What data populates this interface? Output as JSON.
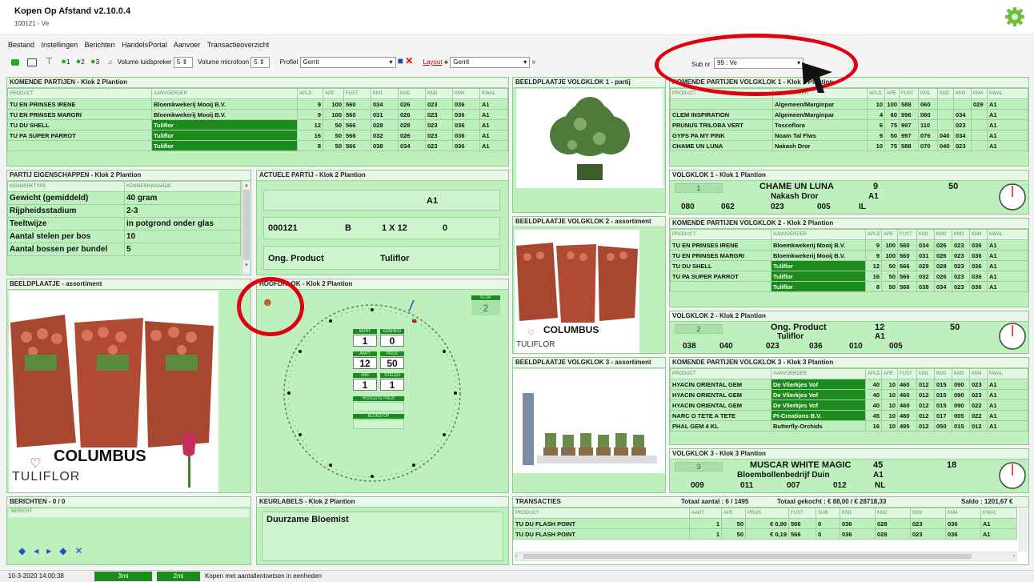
{
  "app": {
    "title": "Kopen Op Afstand v2.10.0.4",
    "subtitle": "100121 - Ve"
  },
  "menu": [
    "Bestand",
    "Instellingen",
    "Berichten",
    "HandelsPortal",
    "Aanvoer",
    "Transactieoverzicht"
  ],
  "toolbar": {
    "clock1": "1",
    "clock2": "2",
    "clock3": "3",
    "vol_speaker_label": "Volume luidspreker",
    "vol_speaker": "5",
    "vol_mic_label": "Volume microfoon",
    "vol_mic": "5",
    "profiel_label": "Profiel",
    "profiel": "Gerrit",
    "layout_label": "Layout",
    "layout": "Gerrit",
    "subnr_label": "Sub nr",
    "subnr": "99 : Ve"
  },
  "kp_main": {
    "title": "KOMENDE PARTIJEN - Klok 2 Plantion",
    "headers": [
      "PRODUCT",
      "AANVOERDER",
      "APLD",
      "APE",
      "FUST",
      "KM1",
      "KM2",
      "KM3",
      "KM4",
      "KWAL"
    ],
    "rows": [
      [
        "TU EN PRINSES IRENE",
        "Bloemkwekerij Mooij B.V.",
        "9",
        "100",
        "560",
        "034",
        "026",
        "023",
        "036",
        "A1"
      ],
      [
        "TU EN PRINSES MARGRI",
        "Bloemkwekerij Mooij B.V.",
        "9",
        "100",
        "560",
        "031",
        "026",
        "023",
        "036",
        "A1"
      ],
      [
        "TU DU SHELL",
        "Tuliflor",
        "12",
        "50",
        "566",
        "028",
        "028",
        "023",
        "036",
        "A1"
      ],
      [
        "TU PA SUPER PARROT",
        "Tuliflor",
        "16",
        "50",
        "566",
        "032",
        "026",
        "023",
        "036",
        "A1"
      ],
      [
        "",
        "Tuliflor",
        "8",
        "50",
        "566",
        "038",
        "034",
        "023",
        "036",
        "A1"
      ]
    ]
  },
  "eig": {
    "title": "PARTIJ EIGENSCHAPPEN - Klok 2 Plantion",
    "h1": "KENMERKTYPE",
    "h2": "KENMERKWAARDE",
    "rows": [
      [
        "Gewicht (gemiddeld)",
        "40 gram"
      ],
      [
        "Rijpheidsstadium",
        "2-3"
      ],
      [
        "Teeltwijze",
        "in potgrond onder glas"
      ],
      [
        "Aantal stelen per bos",
        "10"
      ],
      [
        "Aantal bossen per bundel",
        "5"
      ]
    ]
  },
  "actueel": {
    "title": "ACTUELE PARTIJ - Klok 2 Plantion",
    "kwal": "A1",
    "nr": "000121",
    "b": "B",
    "verp": "1 X 12",
    "zero": "0",
    "product": "Ong. Product",
    "aanvoerder": "Tuliflor"
  },
  "beeld_asso": {
    "title": "BEELDPLAATJE - assortiment",
    "brand": "COLUMBUS",
    "brand2": "TULIFLOR"
  },
  "hoofdklok": {
    "title": "HOOFDKLOK - Klok 2 Plantion",
    "klok_label": "KLOK",
    "klok": "2",
    "l1": "MUNT",
    "l2": "EENHEID",
    "v1": "1",
    "v2": "0",
    "l3": "AANT",
    "l4": "PRIJS",
    "v3": "12",
    "v4": "50",
    "l5": "MIN",
    "l6": "STELEN",
    "v5": "1",
    "v6": "1",
    "l7": "HOOGSTE PRIJS",
    "l8": "BLOKSTOP"
  },
  "berichten": {
    "title": "BERICHTEN - 0 / 0",
    "h": "BERICHT"
  },
  "keur": {
    "title": "KEURLABELS - Klok 2 Plantion",
    "item": "Duurzame Bloemist"
  },
  "bp1": {
    "title": "BEELDPLAATJE VOLGKLOK 1 - partij"
  },
  "bp2": {
    "title": "BEELDPLAATJE VOLGKLOK 2 - assortiment",
    "brand": "COLUMBUS",
    "brand2": "TULIFLOR"
  },
  "bp3": {
    "title": "BEELDPLAATJE VOLGKLOK 3 - assortiment"
  },
  "kpv1": {
    "title": "KOMENDE PARTIJEN VOLGKLOK 1 - Klok 1 Plantion",
    "headers": [
      "PRODUCT",
      "AANVOERDER",
      "APLD",
      "APE",
      "FUST",
      "KM1",
      "KM2",
      "KM3",
      "KM4",
      "KWAL"
    ],
    "rows": [
      [
        "",
        "Algemeen/Marginpar",
        "10",
        "100",
        "588",
        "060",
        "",
        "",
        "029",
        "A1"
      ],
      [
        "CLEM INSPIRATION",
        "Algemeen/Marginpar",
        "4",
        "60",
        "996",
        "060",
        "",
        "034",
        "",
        "A1"
      ],
      [
        "PRUNUS TRILOBA VERT",
        "Toscoflora",
        "6",
        "75",
        "997",
        "110",
        "",
        "023",
        "",
        "A1"
      ],
      [
        "GYPS PA MY PINK",
        "Noam Tal Flws",
        "9",
        "50",
        "997",
        "076",
        "040",
        "034",
        "",
        "A1"
      ],
      [
        "CHAME UN LUNA",
        "Nakash Dror",
        "10",
        "75",
        "588",
        "070",
        "040",
        "023",
        "",
        "A1"
      ]
    ]
  },
  "vk1": {
    "title": "VOLGKLOK 1 - Klok 1 Plantion",
    "klok": "1",
    "product": "CHAME UN LUNA",
    "aanvoerder": "Nakash Dror",
    "aant": "9",
    "prijs": "50",
    "kwal": "A1",
    "k1": "080",
    "k2": "062",
    "k3": "023",
    "k4": "005",
    "land": "IL"
  },
  "kpv2": {
    "title": "KOMENDE PARTIJEN VOLGKLOK 2 - Klok 2 Plantion",
    "headers": [
      "PRODUCT",
      "AANVOERDER",
      "APLD",
      "APE",
      "FUST",
      "KM1",
      "KM2",
      "KM3",
      "KM4",
      "KWAL"
    ],
    "rows": [
      [
        "TU EN PRINSES IRENE",
        "Bloemkwekerij Mooij B.V.",
        "9",
        "100",
        "560",
        "034",
        "026",
        "023",
        "036",
        "A1"
      ],
      [
        "TU EN PRINSES MARGRI",
        "Bloemkwekerij Mooij B.V.",
        "9",
        "100",
        "560",
        "031",
        "026",
        "023",
        "036",
        "A1"
      ],
      [
        "TU DU SHELL",
        "Tuliflor",
        "12",
        "50",
        "566",
        "028",
        "028",
        "023",
        "036",
        "A1"
      ],
      [
        "TU PA SUPER PARROT",
        "Tuliflor",
        "16",
        "50",
        "566",
        "032",
        "026",
        "023",
        "036",
        "A1"
      ],
      [
        "",
        "Tuliflor",
        "8",
        "50",
        "566",
        "038",
        "034",
        "023",
        "036",
        "A1"
      ]
    ]
  },
  "vk2": {
    "title": "VOLGKLOK 2 - Klok 2 Plantion",
    "klok": "2",
    "product": "Ong. Product",
    "aanvoerder": "Tuliflor",
    "aant": "12",
    "prijs": "50",
    "kwal": "A1",
    "k1": "038",
    "k2": "040",
    "k3": "023",
    "k4": "036",
    "k5": "010",
    "k6": "005"
  },
  "kpv3": {
    "title": "KOMENDE PARTIJEN VOLGKLOK 3 - Klok 3 Plantion",
    "headers": [
      "PRODUCT",
      "AANVOERDER",
      "APLD",
      "APE",
      "FUST",
      "KM1",
      "KM2",
      "KM3",
      "KM4",
      "KWAL"
    ],
    "rows": [
      [
        "HYACIN ORIENTAL GEM",
        "De Vlierkjes Vof",
        "40",
        "10",
        "460",
        "012",
        "015",
        "090",
        "023",
        "A1"
      ],
      [
        "HYACIN ORIENTAL GEM",
        "De Vlierkjes Vof",
        "40",
        "10",
        "460",
        "012",
        "015",
        "090",
        "023",
        "A1"
      ],
      [
        "HYACIN ORIENTAL GEM",
        "De Vlierkjes Vof",
        "40",
        "10",
        "460",
        "012",
        "015",
        "090",
        "022",
        "A1"
      ],
      [
        "NARC O TETE A TETE",
        "Pt-Creations B.V.",
        "45",
        "10",
        "480",
        "012",
        "017",
        "005",
        "022",
        "A1"
      ],
      [
        "PHAL GEM 4 KL",
        "Butterfly-Orchids",
        "16",
        "10",
        "495",
        "012",
        "050",
        "015",
        "012",
        "A1"
      ]
    ]
  },
  "vk3": {
    "title": "VOLGKLOK 3 - Klok 3 Plantion",
    "klok": "3",
    "product": "MUSCAR WHITE MAGIC",
    "aanvoerder": "Bloembollenbedrijf Duin",
    "aant": "45",
    "prijs": "18",
    "kwal": "A1",
    "k1": "009",
    "k2": "011",
    "k3": "007",
    "k4": "012",
    "land": "NL"
  },
  "trans": {
    "title": "TRANSACTIES",
    "aantal": "Totaal aantal : 6 / 1495",
    "gekocht": "Totaal gekocht : € 88,00 / € 28718,33",
    "saldo": "Saldo : 1201,67 €",
    "headers": [
      "PRODUCT",
      "AANT",
      "APE",
      "PRIJS",
      "FUST",
      "SUB",
      "KM1",
      "KM2",
      "KM3",
      "KM4",
      "KWAL"
    ],
    "rows": [
      [
        "TU DU FLASH POINT",
        "1",
        "50",
        "€ 0,90",
        "566",
        "0",
        "036",
        "028",
        "023",
        "036",
        "A1"
      ],
      [
        "TU DU FLASH POINT",
        "1",
        "50",
        "€ 0,19",
        "566",
        "0",
        "036",
        "028",
        "023",
        "036",
        "A1"
      ]
    ]
  },
  "status": {
    "datetime": "10-3-2020 14:00:38",
    "s1": "3mi",
    "s2": "2mi",
    "msg": "Kopen met aantallentoetsen in eenheden"
  },
  "colors": {
    "panel": "#bdf0bd",
    "dark_green": "#1d8a1d",
    "red_annotation": "#e00010"
  }
}
